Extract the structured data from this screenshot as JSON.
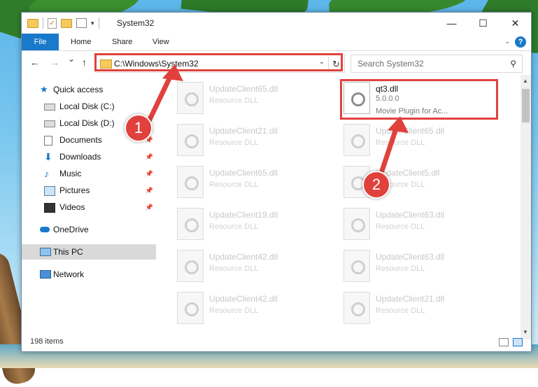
{
  "window": {
    "title": "System32",
    "controls": {
      "minimize": "—",
      "maximize": "☐",
      "close": "✕"
    }
  },
  "ribbon": {
    "file_tab": "File",
    "tabs": [
      "Home",
      "Share",
      "View"
    ],
    "expand_icon": "chevron-down-icon",
    "help": "?"
  },
  "navigation": {
    "back": "←",
    "forward": "→",
    "recent": "⌄",
    "up": "↑",
    "address": "C:\\Windows\\System32",
    "refresh": "↻",
    "search_placeholder": "Search System32"
  },
  "sidebar": {
    "items": [
      {
        "label": "Quick access",
        "icon": "star-icon",
        "pinned": false
      },
      {
        "label": "Local Disk (C:)",
        "icon": "drive-icon",
        "pinned": false
      },
      {
        "label": "Local Disk (D:)",
        "icon": "drive-icon",
        "pinned": false
      },
      {
        "label": "Documents",
        "icon": "documents-icon",
        "pinned": true
      },
      {
        "label": "Downloads",
        "icon": "download-icon",
        "pinned": true
      },
      {
        "label": "Music",
        "icon": "music-icon",
        "pinned": true
      },
      {
        "label": "Pictures",
        "icon": "pictures-icon",
        "pinned": true
      },
      {
        "label": "Videos",
        "icon": "videos-icon",
        "pinned": true
      },
      {
        "label": "OneDrive",
        "icon": "cloud-icon",
        "pinned": false
      },
      {
        "label": "This PC",
        "icon": "computer-icon",
        "pinned": false,
        "selected": true
      },
      {
        "label": "Network",
        "icon": "network-icon",
        "pinned": false
      }
    ]
  },
  "files": {
    "col1": [
      {
        "name": "UpdateClient65.dll",
        "desc": "Resource DLL"
      },
      {
        "name": "UpdateClient21.dll",
        "desc": "Resource DLL"
      },
      {
        "name": "UpdateClient65.dll",
        "desc": "Resource DLL"
      },
      {
        "name": "UpdateClient19.dll",
        "desc": "Resource DLL"
      },
      {
        "name": "UpdateClient42.dll",
        "desc": "Resource DLL"
      },
      {
        "name": "UpdateClient42.dll",
        "desc": "Resource DLL"
      }
    ],
    "col2": [
      {
        "name": "qt3.dll",
        "version": "5.0.0.0",
        "desc": "Movie Plugin for Ac...",
        "highlighted": true
      },
      {
        "name": "UpdateClient65.dll",
        "desc": "Resource DLL"
      },
      {
        "name": "UpdateClient5.dll",
        "desc": "Resource DLL"
      },
      {
        "name": "UpdateClient63.dll",
        "desc": "Resource DLL"
      },
      {
        "name": "UpdateClient63.dll",
        "desc": "Resource DLL"
      },
      {
        "name": "UpdateClient21.dll",
        "desc": "Resource DLL"
      }
    ]
  },
  "status": {
    "item_count": "198 items"
  },
  "callouts": [
    "1",
    "2"
  ],
  "colors": {
    "accent": "#1979ca",
    "highlight": "#e0413d"
  }
}
